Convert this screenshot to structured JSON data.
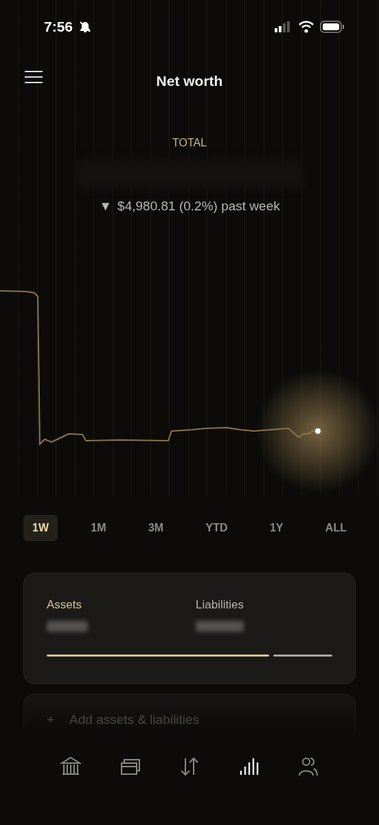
{
  "status_bar": {
    "time": "7:56",
    "silent": true
  },
  "header": {
    "title": "Net worth"
  },
  "summary": {
    "label": "TOTAL",
    "change": {
      "direction": "▼",
      "text": "$4,980.81 (0.2%) past week"
    }
  },
  "ranges": [
    {
      "label": "1W",
      "selected": true
    },
    {
      "label": "1M",
      "selected": false
    },
    {
      "label": "3M",
      "selected": false
    },
    {
      "label": "YTD",
      "selected": false
    },
    {
      "label": "1Y",
      "selected": false
    },
    {
      "label": "ALL",
      "selected": false
    }
  ],
  "balance_card": {
    "assets_label": "Assets",
    "liabilities_label": "Liabilities",
    "assets_share": {
      "level": 0.78
    }
  },
  "add_card": {
    "icon_text": "+",
    "label": "Add assets & liabilities"
  },
  "nav": [
    {
      "selected": false
    },
    {
      "selected": false
    },
    {
      "selected": false
    },
    {
      "selected": true
    },
    {
      "selected": false
    }
  ]
}
